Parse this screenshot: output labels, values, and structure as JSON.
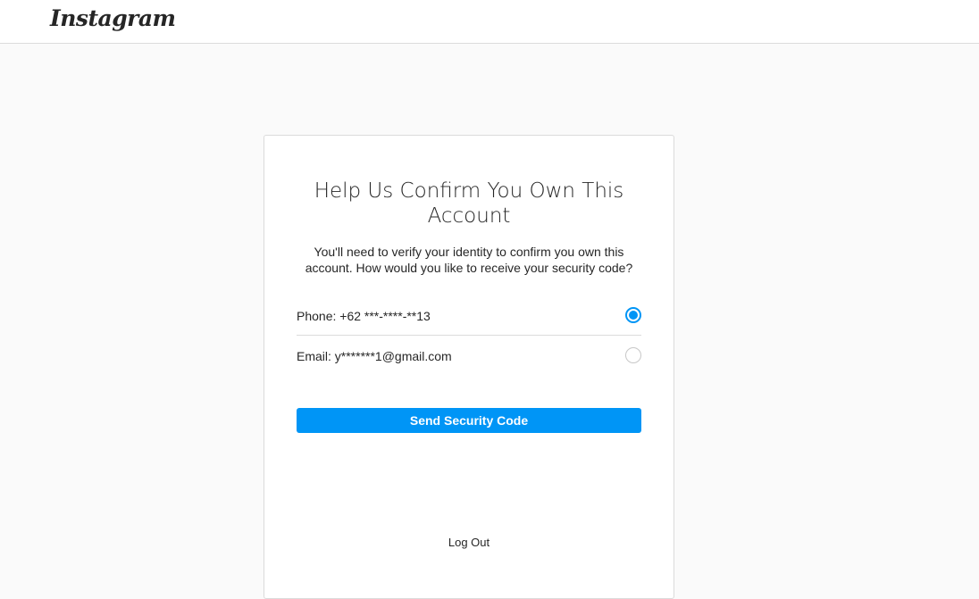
{
  "header": {
    "logo_text": "Instagram"
  },
  "card": {
    "title": "Help Us Confirm You Own This Account",
    "description": "You'll need to verify your identity to confirm you own this account. How would you like to receive your security code?",
    "options": [
      {
        "label": "Phone: +62 ***-****-**13",
        "selected": true
      },
      {
        "label": "Email: y*******1@gmail.com",
        "selected": false
      }
    ],
    "send_button_label": "Send Security Code",
    "logout_label": "Log Out"
  },
  "colors": {
    "accent": "#0095f6",
    "background": "#fafafa",
    "border": "#dbdbdb"
  }
}
